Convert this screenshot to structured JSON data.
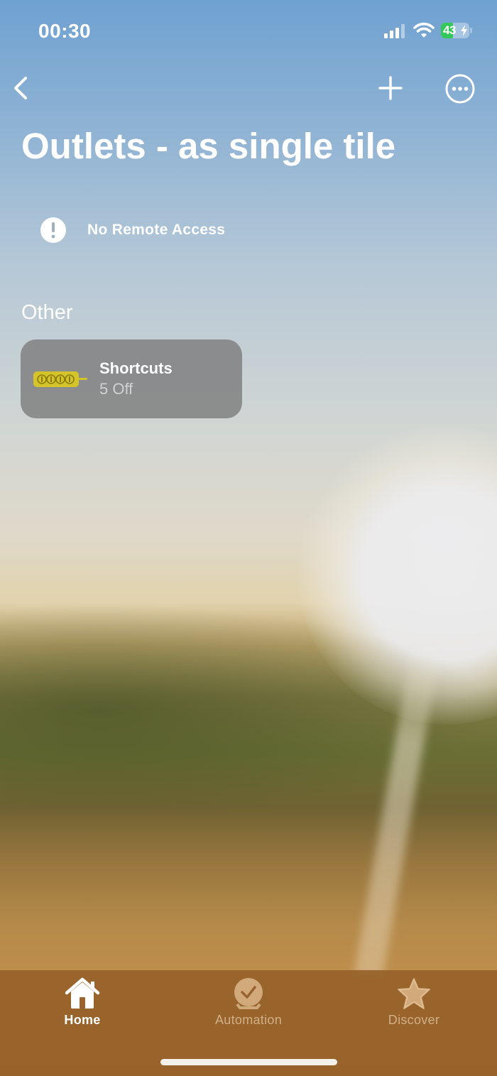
{
  "status_bar": {
    "time": "00:30",
    "battery_level": "43",
    "battery_percent": 43,
    "battery_color": "#34c759"
  },
  "nav": {
    "back_icon": "chevron-left-icon",
    "add_icon": "plus-icon",
    "more_icon": "ellipsis-circle-icon"
  },
  "page": {
    "title": "Outlets - as single tile"
  },
  "remote_access": {
    "icon": "exclamation-circle-icon",
    "label": "No Remote Access"
  },
  "section": {
    "label": "Other"
  },
  "tiles": [
    {
      "name": "Shortcuts",
      "status": "5 Off",
      "icon": "power-strip-icon",
      "icon_color": "#d4c42a"
    }
  ],
  "tab_bar": {
    "tabs": [
      {
        "label": "Home",
        "icon": "house-icon",
        "active": true
      },
      {
        "label": "Automation",
        "icon": "clock-check-icon",
        "active": false
      },
      {
        "label": "Discover",
        "icon": "star-icon",
        "active": false
      }
    ]
  }
}
